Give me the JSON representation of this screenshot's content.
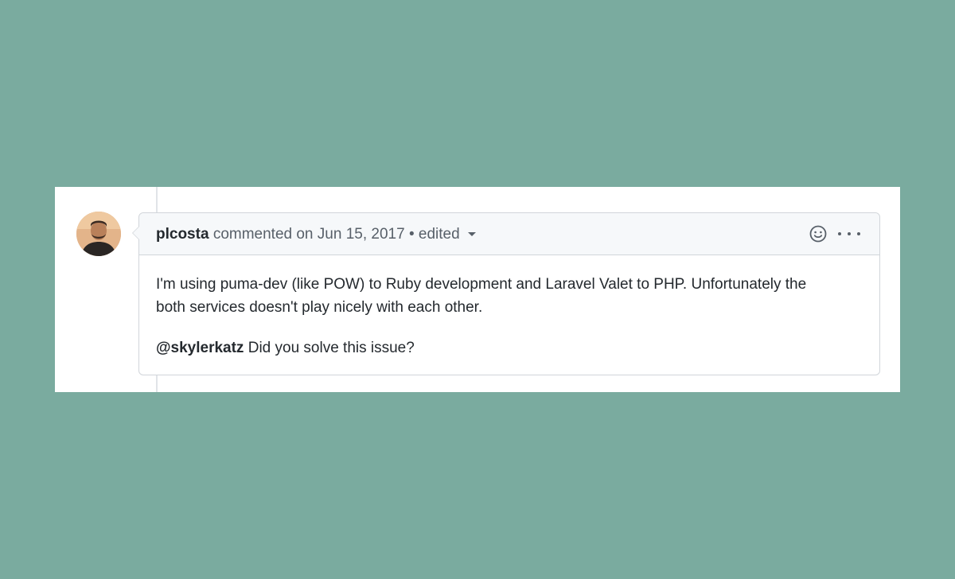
{
  "comment": {
    "author": "plcosta",
    "action": "commented on",
    "date": "Jun 15, 2017",
    "separator": "•",
    "edited_label": "edited",
    "body": {
      "paragraph1_line1": "I'm using puma-dev (like POW) to Ruby development and Laravel Valet to PHP. Unfortunately the",
      "paragraph1_line2": "both services doesn't play nicely with each other.",
      "mention": "@skylerkatz",
      "paragraph2_text": " Did you solve this issue?"
    },
    "icons": {
      "reaction": "smiley-icon",
      "more": "kebab-horizontal-icon",
      "edited_dropdown": "triangle-down-icon"
    }
  },
  "colors": {
    "page_background": "#7aab9f",
    "card_background": "#ffffff",
    "header_background": "#f6f8fa",
    "border": "#d1d5da",
    "muted_text": "#586069",
    "text": "#24292e"
  }
}
